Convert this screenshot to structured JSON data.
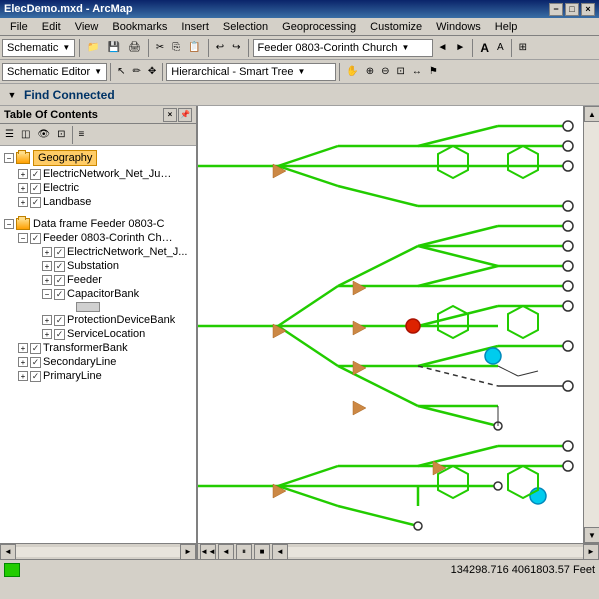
{
  "titleBar": {
    "title": "ElecDemo.mxd - ArcMap",
    "controls": [
      "−",
      "□",
      "×"
    ]
  },
  "menuBar": {
    "items": [
      "File",
      "Edit",
      "View",
      "Bookmarks",
      "Insert",
      "Selection",
      "Geoprocessing",
      "Customize",
      "Windows",
      "Help"
    ]
  },
  "toolbar1": {
    "schematic_label": "Schematic ▼",
    "feeder_dropdown": "Feeder 0803-Corinth Church",
    "icons": [
      "folder",
      "save",
      "print",
      "scissors",
      "copy",
      "paste",
      "undo",
      "redo"
    ]
  },
  "toolbar2": {
    "schematic_editor_label": "Schematic Editor ▼",
    "smart_tree_dropdown": "Hierarchical - Smart Tree",
    "icons": [
      "pointer",
      "pencil",
      "move"
    ]
  },
  "findConnected": {
    "label": "Find Connected",
    "expand_icon": "▼"
  },
  "toc": {
    "title": "Table Of Contents",
    "groups": [
      {
        "id": "geography",
        "label": "Geography",
        "expanded": true,
        "items": [
          {
            "label": "ElectricNetwork_Net_Junc...",
            "checked": true
          },
          {
            "label": "Electric",
            "checked": true
          },
          {
            "label": "Landbase",
            "checked": true
          }
        ]
      },
      {
        "id": "dataframe",
        "label": "Data frame Feeder 0803-C",
        "expanded": true,
        "items": [
          {
            "label": "Feeder 0803-Corinth Chur...",
            "checked": true,
            "subitems": [
              {
                "label": "ElectricNetwork_Net_J...",
                "checked": true
              },
              {
                "label": "Substation",
                "checked": true
              },
              {
                "label": "Feeder",
                "checked": true
              },
              {
                "label": "CapacitorBank",
                "checked": true
              },
              {
                "label": "ProtectionDeviceBank",
                "checked": true
              },
              {
                "label": "ServiceLocation",
                "checked": true
              }
            ]
          },
          {
            "label": "TransformerBank",
            "checked": true
          },
          {
            "label": "SecondaryLine",
            "checked": true
          },
          {
            "label": "PrimaryLine",
            "checked": true
          }
        ]
      }
    ]
  },
  "statusBar": {
    "coords": "134298.716  4061803.57 Feet",
    "nav_buttons": [
      "◄",
      "▶",
      "⏸",
      "■"
    ]
  },
  "map": {
    "background": "#ffffff"
  }
}
